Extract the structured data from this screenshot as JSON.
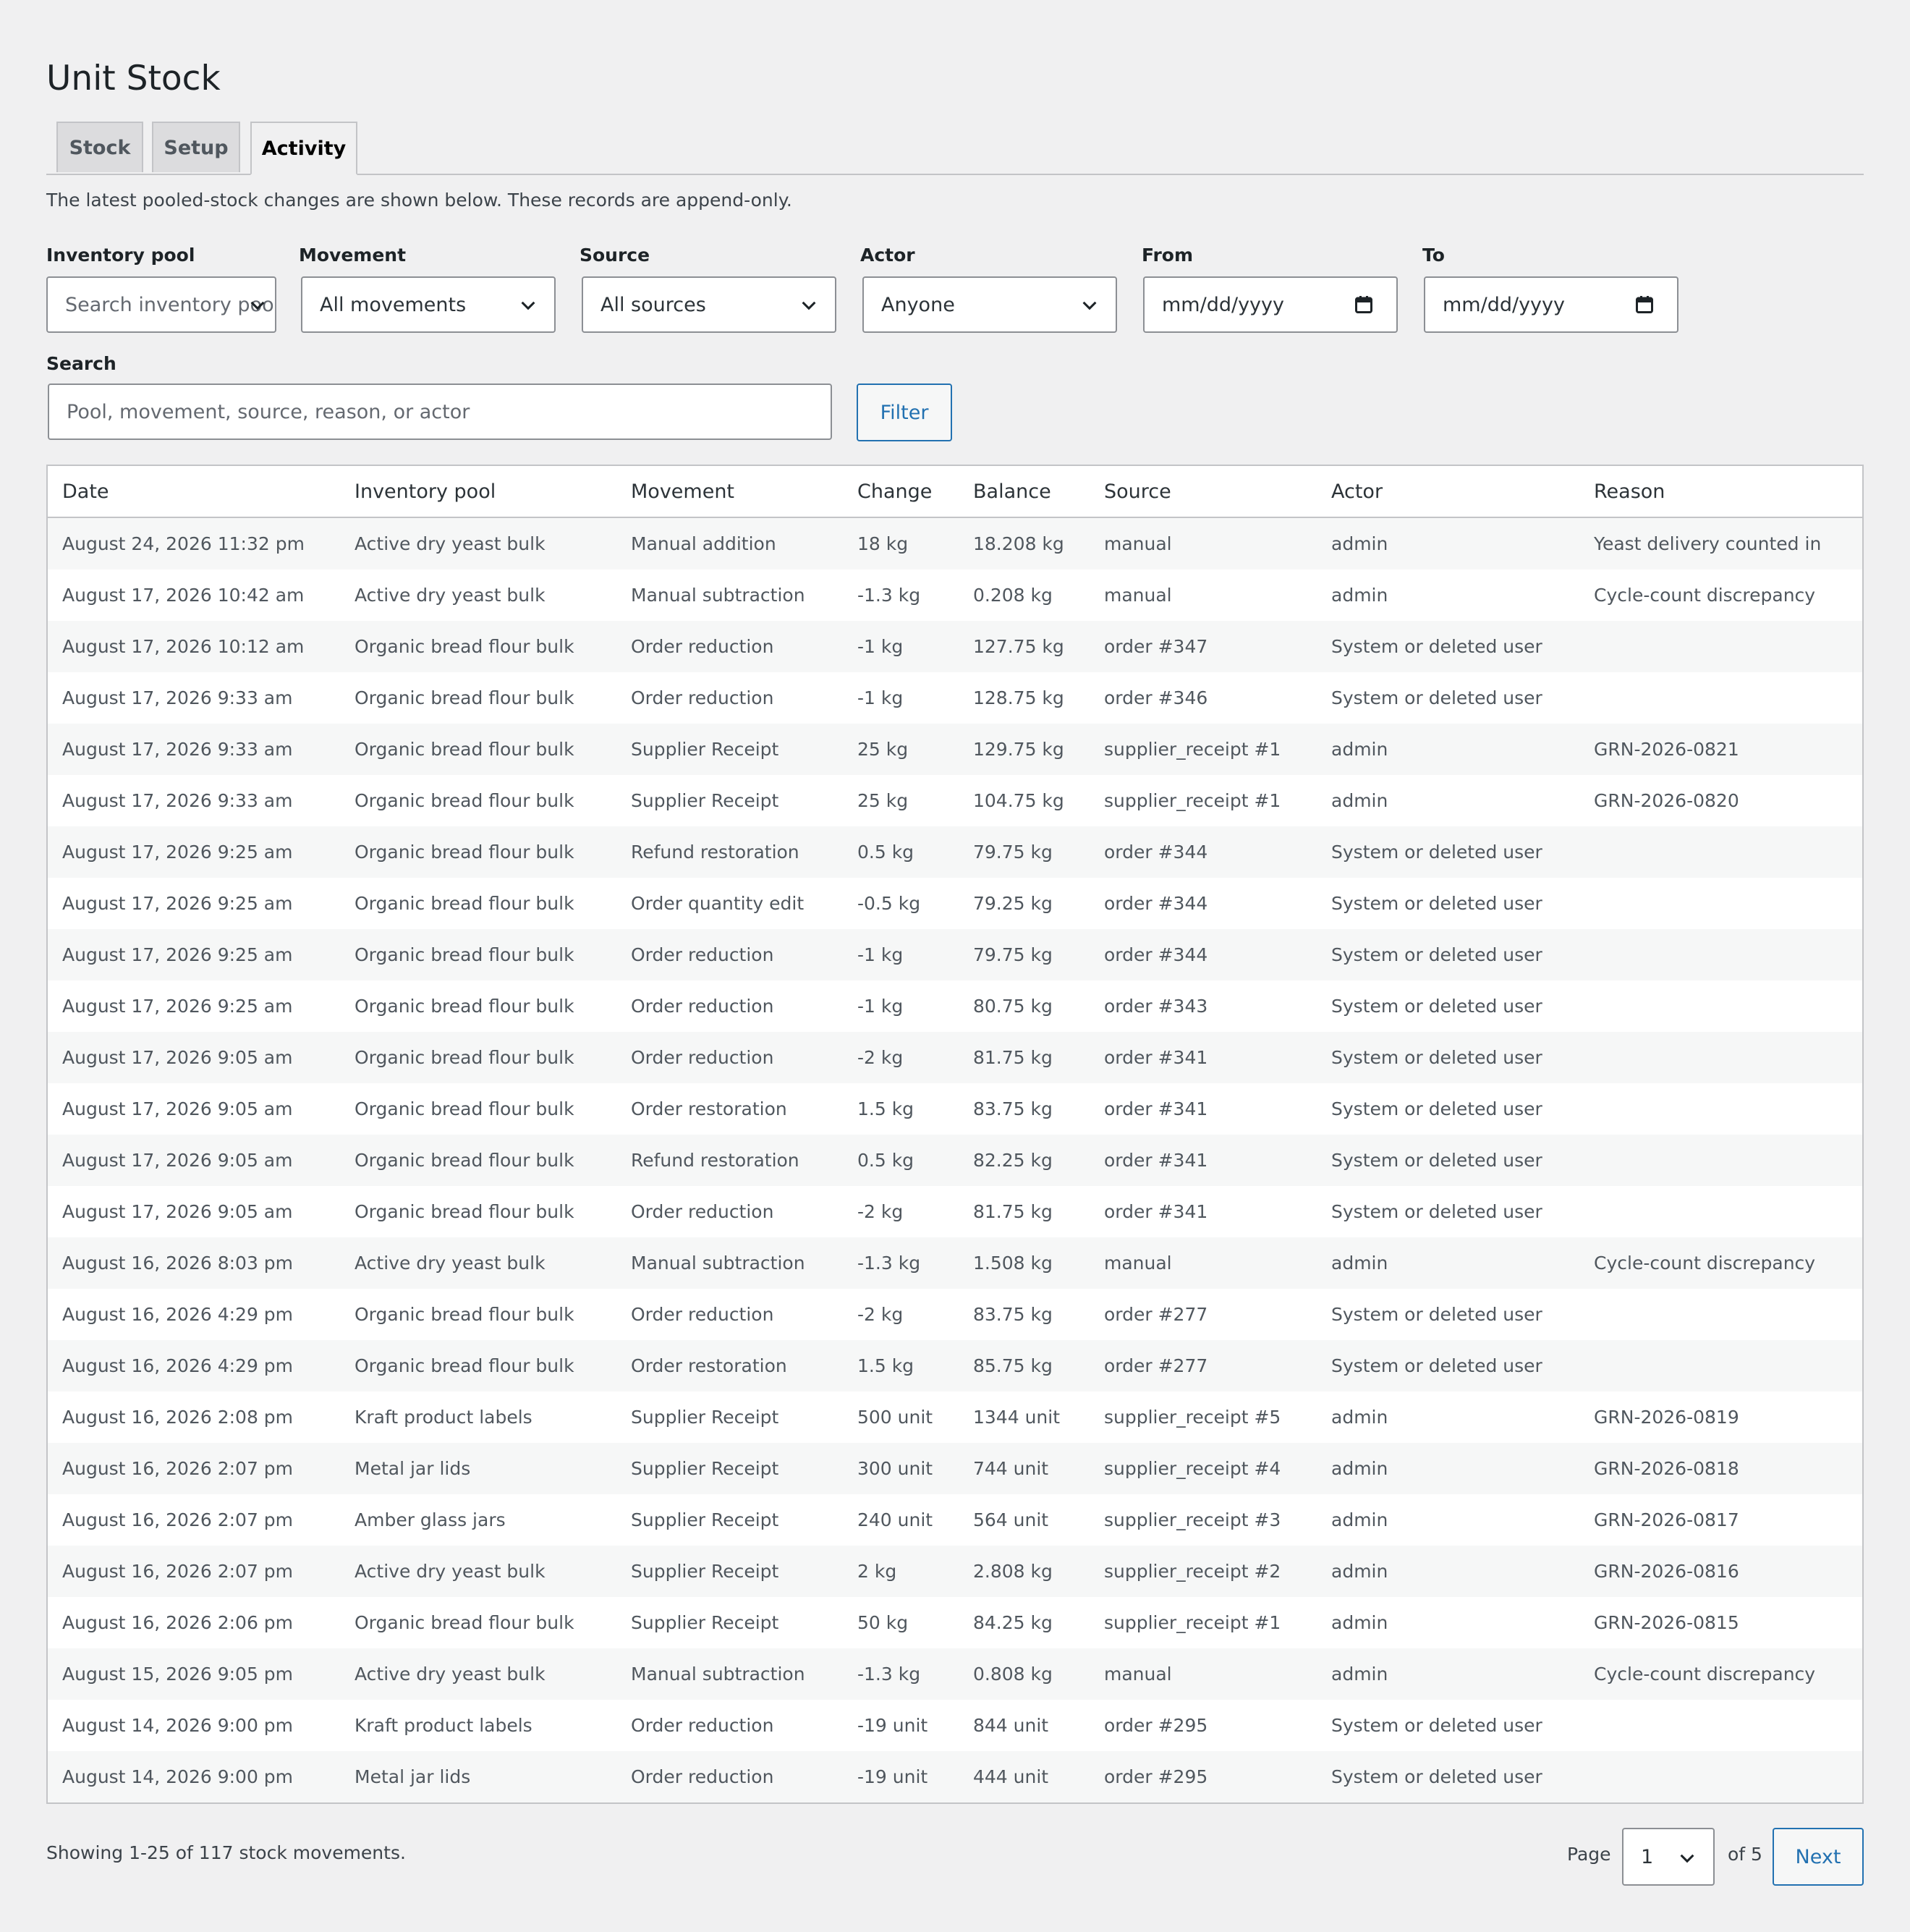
{
  "title": "Unit Stock",
  "tabs": [
    {
      "label": "Stock"
    },
    {
      "label": "Setup"
    },
    {
      "label": "Activity"
    }
  ],
  "intro": "The latest pooled-stock changes are shown below. These records are append-only.",
  "filters": {
    "pool": {
      "label": "Inventory pool",
      "placeholder": "Search inventory pools"
    },
    "movement": {
      "label": "Movement",
      "value": "All movements"
    },
    "source": {
      "label": "Source",
      "value": "All sources"
    },
    "actor": {
      "label": "Actor",
      "value": "Anyone"
    },
    "from": {
      "label": "From",
      "placeholder": "mm/dd/yyyy"
    },
    "to": {
      "label": "To",
      "placeholder": "mm/dd/yyyy"
    },
    "search": {
      "label": "Search",
      "placeholder": "Pool, movement, source, reason, or actor"
    },
    "filter_button": "Filter"
  },
  "table": {
    "columns": [
      "Date",
      "Inventory pool",
      "Movement",
      "Change",
      "Balance",
      "Source",
      "Actor",
      "Reason"
    ],
    "rows": [
      [
        "August 24, 2026 11:32 pm",
        "Active dry yeast bulk",
        "Manual addition",
        "18 kg",
        "18.208 kg",
        "manual",
        "admin",
        "Yeast delivery counted in"
      ],
      [
        "August 17, 2026 10:42 am",
        "Active dry yeast bulk",
        "Manual subtraction",
        "-1.3 kg",
        "0.208 kg",
        "manual",
        "admin",
        "Cycle-count discrepancy"
      ],
      [
        "August 17, 2026 10:12 am",
        "Organic bread flour bulk",
        "Order reduction",
        "-1 kg",
        "127.75 kg",
        "order #347",
        "System or deleted user",
        ""
      ],
      [
        "August 17, 2026 9:33 am",
        "Organic bread flour bulk",
        "Order reduction",
        "-1 kg",
        "128.75 kg",
        "order #346",
        "System or deleted user",
        ""
      ],
      [
        "August 17, 2026 9:33 am",
        "Organic bread flour bulk",
        "Supplier Receipt",
        "25 kg",
        "129.75 kg",
        "supplier_receipt #1",
        "admin",
        "GRN-2026-0821"
      ],
      [
        "August 17, 2026 9:33 am",
        "Organic bread flour bulk",
        "Supplier Receipt",
        "25 kg",
        "104.75 kg",
        "supplier_receipt #1",
        "admin",
        "GRN-2026-0820"
      ],
      [
        "August 17, 2026 9:25 am",
        "Organic bread flour bulk",
        "Refund restoration",
        "0.5 kg",
        "79.75 kg",
        "order #344",
        "System or deleted user",
        ""
      ],
      [
        "August 17, 2026 9:25 am",
        "Organic bread flour bulk",
        "Order quantity edit",
        "-0.5 kg",
        "79.25 kg",
        "order #344",
        "System or deleted user",
        ""
      ],
      [
        "August 17, 2026 9:25 am",
        "Organic bread flour bulk",
        "Order reduction",
        "-1 kg",
        "79.75 kg",
        "order #344",
        "System or deleted user",
        ""
      ],
      [
        "August 17, 2026 9:25 am",
        "Organic bread flour bulk",
        "Order reduction",
        "-1 kg",
        "80.75 kg",
        "order #343",
        "System or deleted user",
        ""
      ],
      [
        "August 17, 2026 9:05 am",
        "Organic bread flour bulk",
        "Order reduction",
        "-2 kg",
        "81.75 kg",
        "order #341",
        "System or deleted user",
        ""
      ],
      [
        "August 17, 2026 9:05 am",
        "Organic bread flour bulk",
        "Order restoration",
        "1.5 kg",
        "83.75 kg",
        "order #341",
        "System or deleted user",
        ""
      ],
      [
        "August 17, 2026 9:05 am",
        "Organic bread flour bulk",
        "Refund restoration",
        "0.5 kg",
        "82.25 kg",
        "order #341",
        "System or deleted user",
        ""
      ],
      [
        "August 17, 2026 9:05 am",
        "Organic bread flour bulk",
        "Order reduction",
        "-2 kg",
        "81.75 kg",
        "order #341",
        "System or deleted user",
        ""
      ],
      [
        "August 16, 2026 8:03 pm",
        "Active dry yeast bulk",
        "Manual subtraction",
        "-1.3 kg",
        "1.508 kg",
        "manual",
        "admin",
        "Cycle-count discrepancy"
      ],
      [
        "August 16, 2026 4:29 pm",
        "Organic bread flour bulk",
        "Order reduction",
        "-2 kg",
        "83.75 kg",
        "order #277",
        "System or deleted user",
        ""
      ],
      [
        "August 16, 2026 4:29 pm",
        "Organic bread flour bulk",
        "Order restoration",
        "1.5 kg",
        "85.75 kg",
        "order #277",
        "System or deleted user",
        ""
      ],
      [
        "August 16, 2026 2:08 pm",
        "Kraft product labels",
        "Supplier Receipt",
        "500 unit",
        "1344 unit",
        "supplier_receipt #5",
        "admin",
        "GRN-2026-0819"
      ],
      [
        "August 16, 2026 2:07 pm",
        "Metal jar lids",
        "Supplier Receipt",
        "300 unit",
        "744 unit",
        "supplier_receipt #4",
        "admin",
        "GRN-2026-0818"
      ],
      [
        "August 16, 2026 2:07 pm",
        "Amber glass jars",
        "Supplier Receipt",
        "240 unit",
        "564 unit",
        "supplier_receipt #3",
        "admin",
        "GRN-2026-0817"
      ],
      [
        "August 16, 2026 2:07 pm",
        "Active dry yeast bulk",
        "Supplier Receipt",
        "2 kg",
        "2.808 kg",
        "supplier_receipt #2",
        "admin",
        "GRN-2026-0816"
      ],
      [
        "August 16, 2026 2:06 pm",
        "Organic bread flour bulk",
        "Supplier Receipt",
        "50 kg",
        "84.25 kg",
        "supplier_receipt #1",
        "admin",
        "GRN-2026-0815"
      ],
      [
        "August 15, 2026 9:05 pm",
        "Active dry yeast bulk",
        "Manual subtraction",
        "-1.3 kg",
        "0.808 kg",
        "manual",
        "admin",
        "Cycle-count discrepancy"
      ],
      [
        "August 14, 2026 9:00 pm",
        "Kraft product labels",
        "Order reduction",
        "-19 unit",
        "844 unit",
        "order #295",
        "System or deleted user",
        ""
      ],
      [
        "August 14, 2026 9:00 pm",
        "Metal jar lids",
        "Order reduction",
        "-19 unit",
        "444 unit",
        "order #295",
        "System or deleted user",
        ""
      ]
    ]
  },
  "footer": {
    "showing": "Showing 1-25 of 117 stock movements.",
    "page_label": "Page",
    "page_value": "1",
    "of_label": "of 5",
    "next": "Next"
  }
}
